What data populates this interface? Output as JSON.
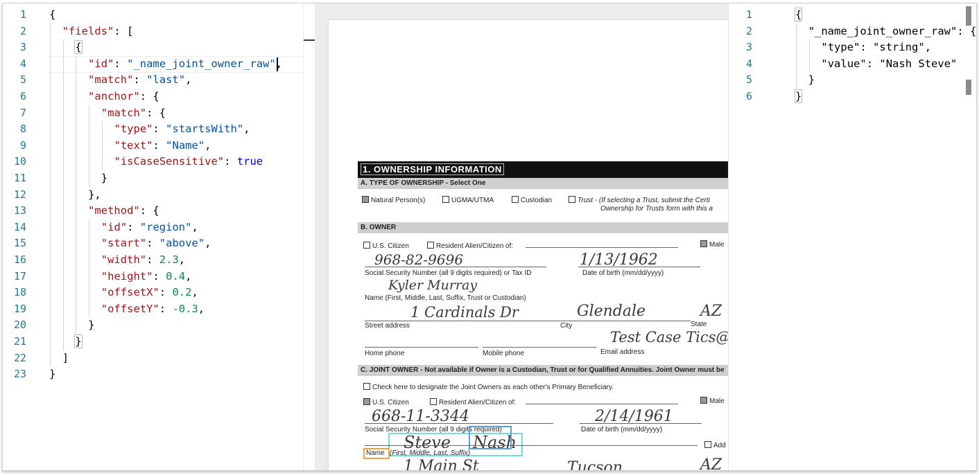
{
  "left_editor": {
    "lines": [
      {
        "n": "1",
        "indent": 0,
        "tokens": [
          [
            "punc",
            "{"
          ]
        ]
      },
      {
        "n": "2",
        "indent": 1,
        "tokens": [
          [
            "k",
            "\"fields\""
          ],
          [
            "punc",
            ": ["
          ]
        ]
      },
      {
        "n": "3",
        "indent": 2,
        "tokens": [
          [
            "punc",
            "{"
          ]
        ]
      },
      {
        "n": "4",
        "indent": 3,
        "tokens": [
          [
            "k",
            "\"id\""
          ],
          [
            "punc",
            ": "
          ],
          [
            "s",
            "\"_name_joint_owner_raw\""
          ],
          [
            "punc",
            ","
          ]
        ]
      },
      {
        "n": "5",
        "indent": 3,
        "tokens": [
          [
            "k",
            "\"match\""
          ],
          [
            "punc",
            ": "
          ],
          [
            "s",
            "\"last\""
          ],
          [
            "punc",
            ","
          ]
        ]
      },
      {
        "n": "6",
        "indent": 3,
        "tokens": [
          [
            "k",
            "\"anchor\""
          ],
          [
            "punc",
            ": {"
          ]
        ]
      },
      {
        "n": "7",
        "indent": 4,
        "tokens": [
          [
            "k",
            "\"match\""
          ],
          [
            "punc",
            ": {"
          ]
        ]
      },
      {
        "n": "8",
        "indent": 5,
        "tokens": [
          [
            "k",
            "\"type\""
          ],
          [
            "punc",
            ": "
          ],
          [
            "s",
            "\"startsWith\""
          ],
          [
            "punc",
            ","
          ]
        ]
      },
      {
        "n": "9",
        "indent": 5,
        "tokens": [
          [
            "k",
            "\"text\""
          ],
          [
            "punc",
            ": "
          ],
          [
            "s",
            "\"Name\""
          ],
          [
            "punc",
            ","
          ]
        ]
      },
      {
        "n": "10",
        "indent": 5,
        "tokens": [
          [
            "k",
            "\"isCaseSensitive\""
          ],
          [
            "punc",
            ": "
          ],
          [
            "b",
            "true"
          ]
        ]
      },
      {
        "n": "11",
        "indent": 4,
        "tokens": [
          [
            "punc",
            "}"
          ]
        ]
      },
      {
        "n": "12",
        "indent": 3,
        "tokens": [
          [
            "punc",
            "},"
          ]
        ]
      },
      {
        "n": "13",
        "indent": 3,
        "tokens": [
          [
            "k",
            "\"method\""
          ],
          [
            "punc",
            ": {"
          ]
        ]
      },
      {
        "n": "14",
        "indent": 4,
        "tokens": [
          [
            "k",
            "\"id\""
          ],
          [
            "punc",
            ": "
          ],
          [
            "s",
            "\"region\""
          ],
          [
            "punc",
            ","
          ]
        ]
      },
      {
        "n": "15",
        "indent": 4,
        "tokens": [
          [
            "k",
            "\"start\""
          ],
          [
            "punc",
            ": "
          ],
          [
            "s",
            "\"above\""
          ],
          [
            "punc",
            ","
          ]
        ]
      },
      {
        "n": "16",
        "indent": 4,
        "tokens": [
          [
            "k",
            "\"width\""
          ],
          [
            "punc",
            ": "
          ],
          [
            "n",
            "2.3"
          ],
          [
            "punc",
            ","
          ]
        ]
      },
      {
        "n": "17",
        "indent": 4,
        "tokens": [
          [
            "k",
            "\"height\""
          ],
          [
            "punc",
            ": "
          ],
          [
            "n",
            "0.4"
          ],
          [
            "punc",
            ","
          ]
        ]
      },
      {
        "n": "18",
        "indent": 4,
        "tokens": [
          [
            "k",
            "\"offsetX\""
          ],
          [
            "punc",
            ": "
          ],
          [
            "n",
            "0.2"
          ],
          [
            "punc",
            ","
          ]
        ]
      },
      {
        "n": "19",
        "indent": 4,
        "tokens": [
          [
            "k",
            "\"offsetY\""
          ],
          [
            "punc",
            ": "
          ],
          [
            "n",
            "-0.3"
          ],
          [
            "punc",
            ","
          ]
        ]
      },
      {
        "n": "20",
        "indent": 3,
        "tokens": [
          [
            "punc",
            "}"
          ]
        ]
      },
      {
        "n": "21",
        "indent": 2,
        "tokens": [
          [
            "punc",
            "}"
          ]
        ]
      },
      {
        "n": "22",
        "indent": 1,
        "tokens": [
          [
            "punc",
            "]"
          ]
        ]
      },
      {
        "n": "23",
        "indent": 0,
        "tokens": [
          [
            "punc",
            "}"
          ]
        ]
      }
    ]
  },
  "right_editor": {
    "lines": [
      {
        "n": "1",
        "indent": 0,
        "tokens": [
          [
            "punc",
            "{"
          ]
        ]
      },
      {
        "n": "2",
        "indent": 1,
        "tokens": [
          [
            "punc",
            "\"_name_joint_owner_raw\": {"
          ]
        ]
      },
      {
        "n": "3",
        "indent": 2,
        "tokens": [
          [
            "punc",
            "\"type\": \"string\","
          ]
        ]
      },
      {
        "n": "4",
        "indent": 2,
        "tokens": [
          [
            "punc",
            "\"value\": \"Nash Steve\""
          ]
        ]
      },
      {
        "n": "5",
        "indent": 1,
        "tokens": [
          [
            "punc",
            "}"
          ]
        ]
      },
      {
        "n": "6",
        "indent": 0,
        "tokens": [
          [
            "punc",
            "}"
          ]
        ]
      }
    ]
  },
  "document": {
    "section_title": "1. OWNERSHIP INFORMATION",
    "a_header": "A. TYPE OF OWNERSHIP - Select One",
    "a_opt_natural": "Natural Person(s)",
    "a_opt_ugma": "UGMA/UTMA",
    "a_opt_custodian": "Custodian",
    "a_opt_trust": "Trust - (If selecting a Trust, submit the Certi",
    "a_opt_trust2": "Ownership for Trusts form with this a",
    "b_header": "B. OWNER",
    "b_us_citizen": "U.S. Citizen",
    "b_resident": "Resident Alien/Citizen of:",
    "b_male": "Male",
    "b_ssn_hw": "968-82-9696",
    "b_dob_hw": "1/13/1962",
    "b_ssn_label": "Social Security Number (all 9 digits required) or Tax ID",
    "b_dob_label": "Date of birth (mm/dd/yyyy)",
    "b_name_hw": "Kyler  Murray",
    "b_name_label": "Name (First, Middle, Last, Suffix, Trust or Custodian)",
    "b_street_hw": "1  Cardinals  Dr",
    "b_city_hw": "Glendale",
    "b_state_hw": "AZ",
    "b_street_label": "Street address",
    "b_city_label": "City",
    "b_state_label": "State",
    "b_email_hw": "Test Case Tics@ A",
    "b_home_label": "Home phone",
    "b_mobile_label": "Mobile phone",
    "b_email_label": "Email address",
    "c_header": "C. JOINT OWNER - Not available if Owner is a Custodian, Trust or for Qualified Annuities. Joint Owner must be",
    "c_check": "Check here to designate the Joint Owners as each other's Primary Beneficiary.",
    "c_us_citizen": "U.S. Citizen",
    "c_resident": "Resident Alien/Citizen of:",
    "c_male": "Male",
    "c_ssn_hw": "668-11-3344",
    "c_dob_hw": "2/14/1961",
    "c_ssn_label": "Social Security Number (all 9 digits required)",
    "c_dob_label": "Date of birth (mm/dd/yyyy)",
    "c_name_hw_first": "Steve",
    "c_name_hw_last": "Nash",
    "c_add": "Add",
    "c_name_label": "Name",
    "c_name_label_rest": "(First, Middle, Last, Suffix)",
    "c_street_hw": "1  Main  St",
    "c_city_hw": "Tucson",
    "c_state_hw": "AZ"
  }
}
